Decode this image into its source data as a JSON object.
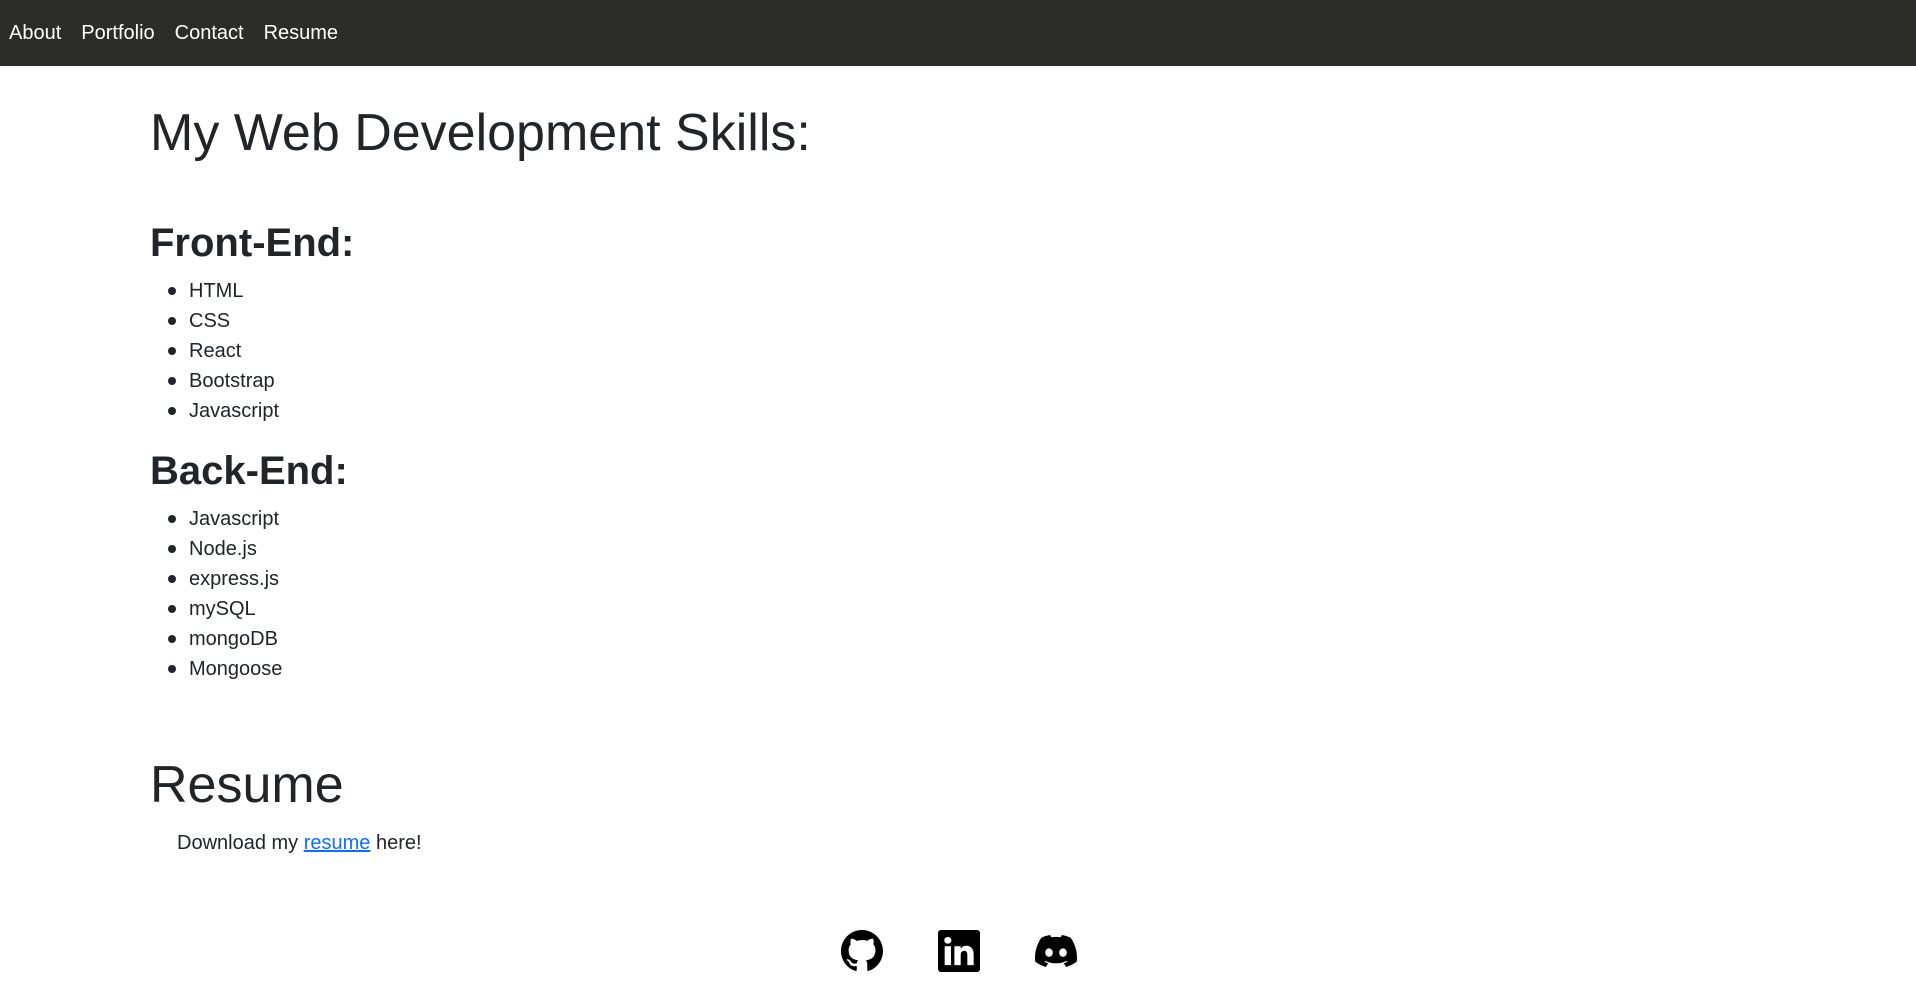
{
  "nav": {
    "items": [
      {
        "label": "About"
      },
      {
        "label": "Portfolio"
      },
      {
        "label": "Contact"
      },
      {
        "label": "Resume"
      }
    ]
  },
  "skills": {
    "title": "My Web Development Skills:",
    "frontend": {
      "heading": "Front-End:",
      "items": [
        "HTML",
        "CSS",
        "React",
        "Bootstrap",
        "Javascript"
      ]
    },
    "backend": {
      "heading": "Back-End:",
      "items": [
        "Javascript",
        "Node.js",
        "express.js",
        "mySQL",
        "mongoDB",
        "Mongoose"
      ]
    }
  },
  "resume": {
    "title": "Resume",
    "text_before": "Download my ",
    "link_label": "resume",
    "text_after": " here!"
  },
  "footer": {
    "icons": [
      "github-icon",
      "linkedin-icon",
      "discord-icon"
    ]
  },
  "colors": {
    "navbar_bg": "#2c2c29",
    "link": "#0d6efd",
    "text": "#212529"
  }
}
